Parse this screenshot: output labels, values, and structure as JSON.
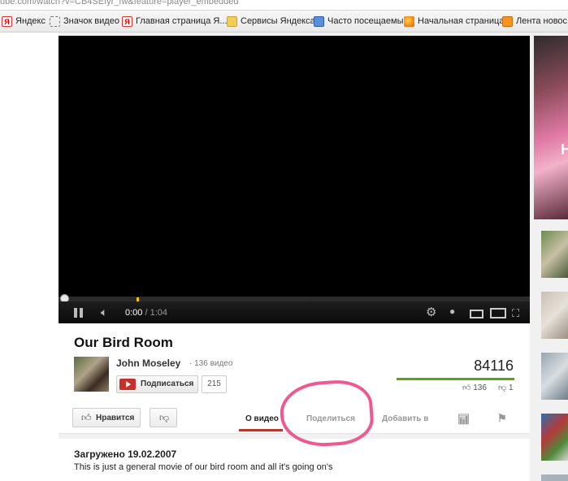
{
  "browser": {
    "url": "ube.com/watch?v=CB4SEIyr_fw&feature=player_embedded"
  },
  "bookmarks": [
    {
      "label": "Яндекс",
      "icon": "yandex-icon"
    },
    {
      "label": "Значок видео",
      "icon": "dashed-box-icon"
    },
    {
      "label": "Главная страница Я...",
      "icon": "yandex-icon"
    },
    {
      "label": "Сервисы Яндекса",
      "icon": "folder-icon"
    },
    {
      "label": "Часто посещаемые",
      "icon": "frequent-icon"
    },
    {
      "label": "Начальная страница",
      "icon": "firefox-icon"
    },
    {
      "label": "Лента новос",
      "icon": "rss-icon"
    }
  ],
  "player": {
    "current_time": "0:00",
    "duration": "/ 1:04",
    "progress_fraction": 0.0
  },
  "video": {
    "title": "Our Bird Room",
    "channel": "John Moseley",
    "channel_videos": "· 136 видео",
    "subscribe_label": "Подписаться",
    "subscriber_count": "215",
    "views": "84116",
    "likes": "136",
    "dislikes": "1",
    "like_label": "Нравится"
  },
  "tabs": {
    "about": "О видео",
    "share": "Поделиться",
    "add": "Добавить в"
  },
  "description": {
    "uploaded": "Загружено 19.02.2007",
    "text": "This is just a general movie of our bird room and all it's going on's"
  },
  "sidebar": {
    "ad_letter": "Н"
  },
  "colors": {
    "annotation_circle": "#f05890",
    "sentiment_bar": "#5aa514",
    "tab_active": "#b03a2e",
    "subscribe_red": "#c8312b"
  }
}
